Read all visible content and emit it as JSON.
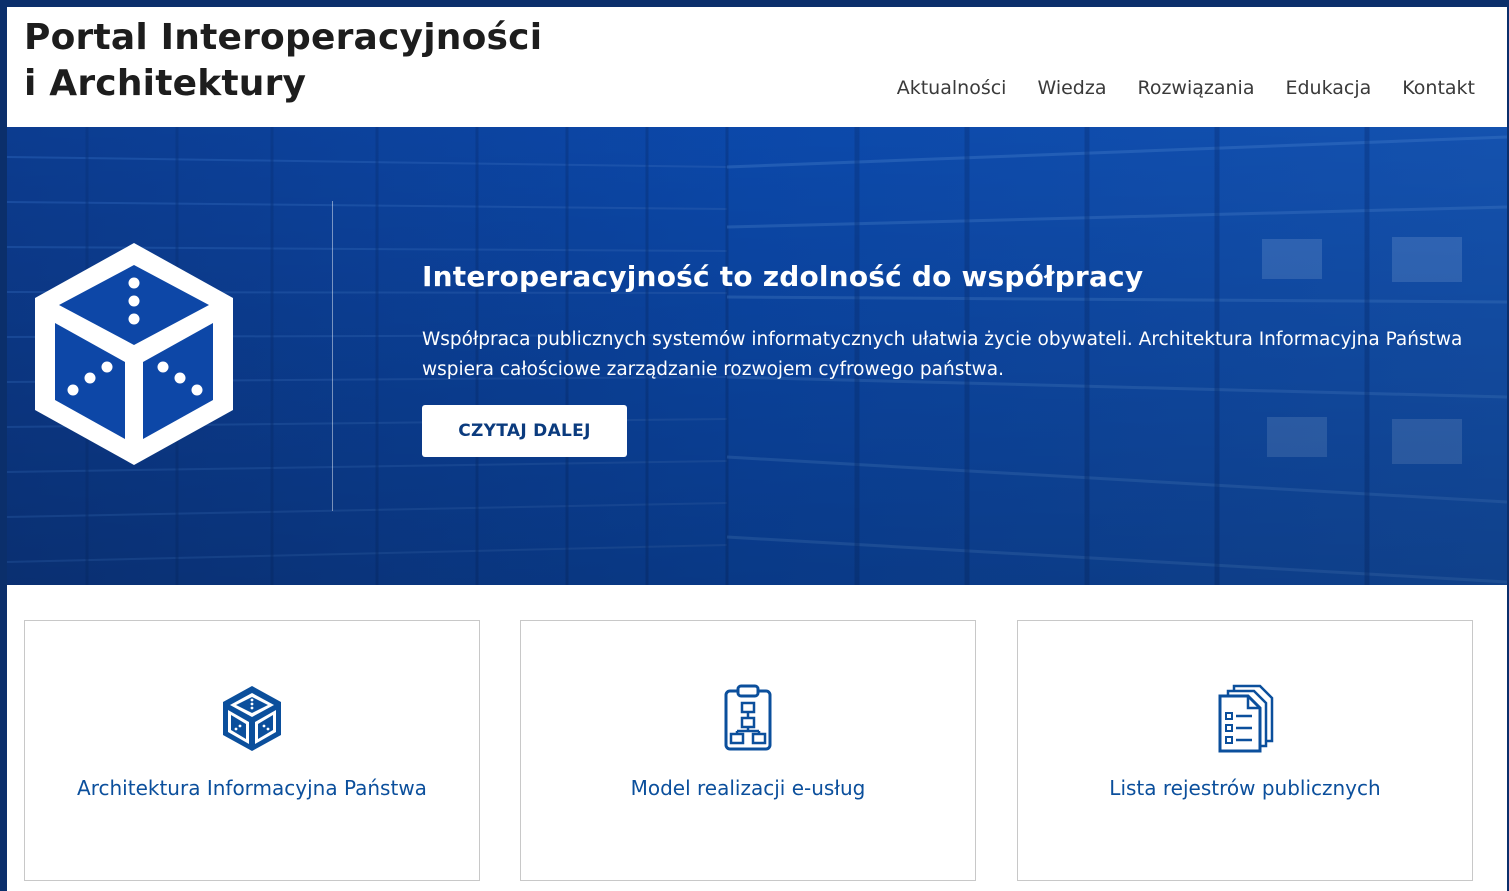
{
  "site": {
    "title_line1": "Portal Interoperacyjności",
    "title_line2": "i Architektury"
  },
  "nav": {
    "items": [
      {
        "label": "Aktualności"
      },
      {
        "label": "Wiedza"
      },
      {
        "label": "Rozwiązania"
      },
      {
        "label": "Edukacja"
      },
      {
        "label": "Kontakt"
      }
    ]
  },
  "hero": {
    "heading": "Interoperacyjność to zdolność do współpracy",
    "text": "Współpraca publicznych systemów informatycznych ułatwia życie obywateli. Architektura Informacyjna Państwa wspiera całościowe zarządzanie rozwojem cyfrowego państwa.",
    "button_label": "CZYTAJ DALEJ",
    "icon": "cube-icon"
  },
  "cards": [
    {
      "label": "Architektura Informacyjna Państwa",
      "icon": "cube-icon"
    },
    {
      "label": "Model realizacji e-usług",
      "icon": "clipboard-flowchart-icon"
    },
    {
      "label": "Lista rejestrów publicznych",
      "icon": "documents-list-icon"
    }
  ],
  "colors": {
    "frame": "#0b2f6b",
    "hero_blue": "#0e4fb0",
    "link_blue": "#0b4f9c",
    "button_text": "#0b3b7e"
  }
}
